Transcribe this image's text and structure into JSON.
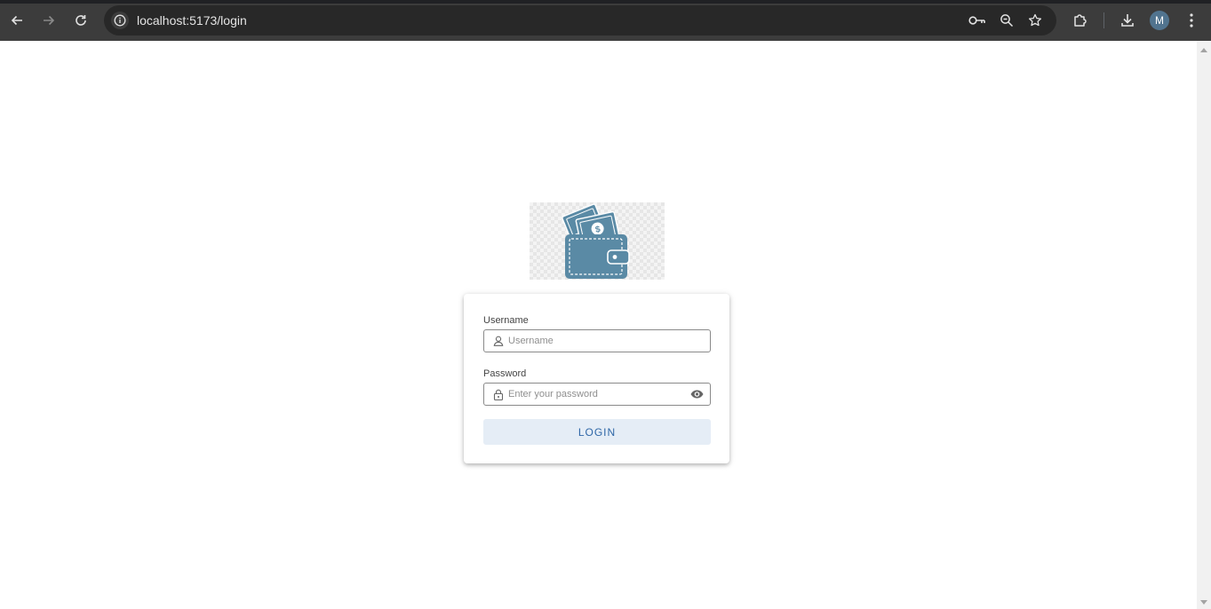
{
  "browser": {
    "url": "localhost:5173/login",
    "profile_initial": "M",
    "icons": [
      "back-icon",
      "forward-icon",
      "reload-icon",
      "info-icon",
      "password-key-icon",
      "zoom-icon",
      "bookmark-star-icon",
      "extensions-icon",
      "download-icon",
      "more-vert-icon"
    ]
  },
  "login": {
    "logo": "wallet-logo",
    "username_label": "Username",
    "username_placeholder": "Username",
    "password_label": "Password",
    "password_placeholder": "Enter your password",
    "login_button": "LOGIN"
  },
  "colors": {
    "chrome_bg": "#3c3c3c",
    "omnibox_bg": "#282828",
    "wallet": "#5a8aa5",
    "button_bg": "#e5edf6",
    "button_text": "#2f67a7"
  }
}
